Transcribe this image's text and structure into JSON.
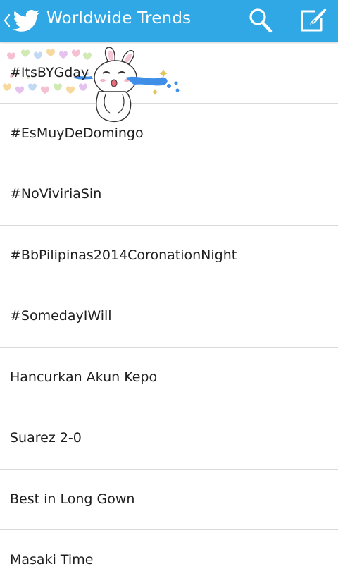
{
  "header": {
    "title": "Worldwide Trends",
    "background": "#2fa8e5"
  },
  "icons": {
    "back": "chevron-left-icon",
    "brand": "bird-icon",
    "search": "search-icon",
    "compose": "compose-icon"
  },
  "trends": [
    {
      "label": "#ItsBYGday"
    },
    {
      "label": "#EsMuyDeDomingo"
    },
    {
      "label": "#NoViviriaSin"
    },
    {
      "label": "#BbPilipinas2014CoronationNight"
    },
    {
      "label": "#SomedayIWill"
    },
    {
      "label": "Hancurkan Akun Kepo"
    },
    {
      "label": "Suarez 2-0"
    },
    {
      "label": "Best in Long Gown"
    },
    {
      "label": "Masaki Time"
    }
  ],
  "colors": {
    "divider": "#d9d9d9",
    "text": "#1e1e1e"
  }
}
